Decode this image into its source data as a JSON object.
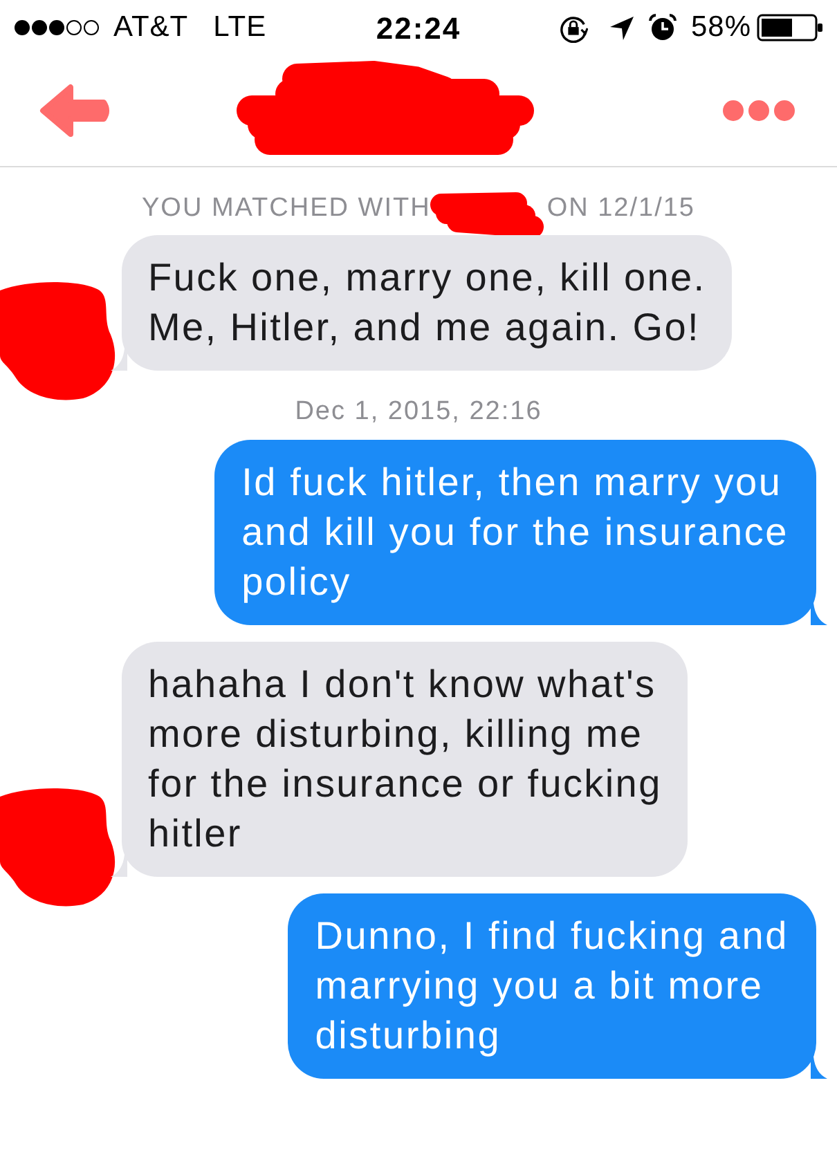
{
  "status_bar": {
    "carrier": "AT&T",
    "network": "LTE",
    "time": "22:24",
    "battery": "58%"
  },
  "match_notice": {
    "prefix": "YOU MATCHED WITH",
    "suffix": "ON 12/1/15"
  },
  "messages": [
    {
      "kind": "received",
      "text": "Fuck one, marry one, kill one.\nMe, Hitler, and me again. Go!"
    },
    {
      "kind": "timestamp",
      "text": "Dec 1, 2015, 22:16"
    },
    {
      "kind": "sent",
      "text": "Id fuck hitler, then marry you\nand kill you for the insurance\npolicy"
    },
    {
      "kind": "received",
      "text": "hahaha I don't know what's\nmore disturbing, killing me\nfor the insurance or fucking\nhitler"
    },
    {
      "kind": "sent",
      "text": "Dunno, I find fucking and\nmarrying you a bit more\ndisturbing"
    }
  ]
}
